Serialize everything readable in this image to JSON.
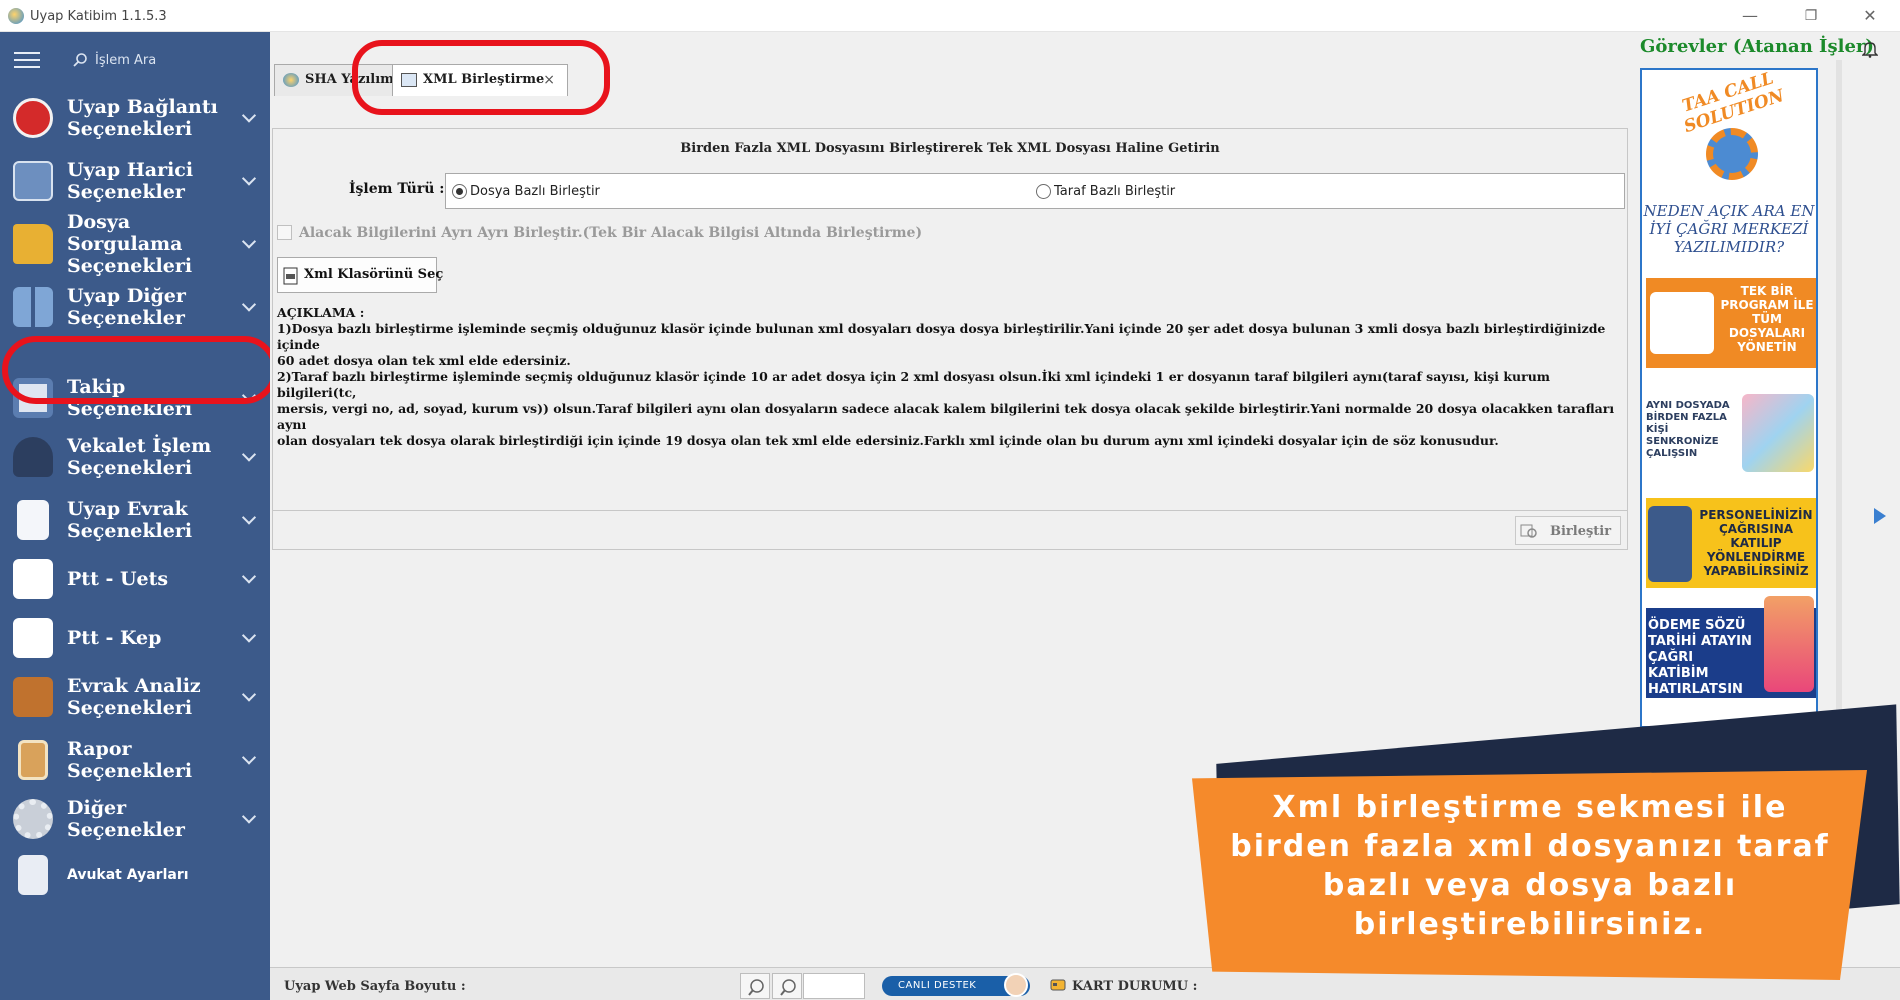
{
  "window": {
    "title": "Uyap Katibim 1.1.5.3",
    "controls": [
      "—",
      "❐",
      "✕"
    ]
  },
  "sidebar": {
    "search_label": "İşlem Ara",
    "items": [
      {
        "label": "Uyap Bağlantı Seçenekleri",
        "icon": "uyap-logo-icon"
      },
      {
        "label": "Uyap Harici Seçenekler",
        "icon": "help-book-icon"
      },
      {
        "label": "Dosya Sorgulama Seçenekleri",
        "icon": "folder-icon"
      },
      {
        "label": "Uyap Diğer Seçenekler",
        "icon": "grid-icon"
      },
      {
        "label": "Takip Seçenekleri",
        "icon": "frame-icon"
      },
      {
        "label": "Vekalet İşlem Seçenekleri",
        "icon": "lawyer-icon"
      },
      {
        "label": "Uyap Evrak Seçenekleri",
        "icon": "document-icon"
      },
      {
        "label": "Ptt - Uets",
        "icon": "ptt-icon"
      },
      {
        "label": "Ptt - Kep",
        "icon": "ptt-icon"
      },
      {
        "label": "Evrak Analiz Seçenekleri",
        "icon": "briefcase-icon"
      },
      {
        "label": "Rapor Seçenekleri",
        "icon": "clipboard-icon"
      },
      {
        "label": "Diğer Seçenekler",
        "icon": "gear-icon"
      },
      {
        "label": "Avukat Ayarları",
        "icon": "user-card-icon"
      }
    ]
  },
  "tabs": [
    {
      "label": "SHA Yazılım",
      "active": false
    },
    {
      "label": "XML Birleştirme",
      "active": true,
      "close": "×"
    }
  ],
  "panel": {
    "title": "Birden Fazla XML Dosyasını Birleştirerek Tek XML Dosyası Haline Getirin",
    "islem_label": "İşlem Türü :",
    "radio_options": [
      {
        "label": "Dosya Bazlı Birleştir",
        "selected": true
      },
      {
        "label": "Taraf Bazlı Birleştir",
        "selected": false
      }
    ],
    "checkbox_label": "Alacak Bilgilerini Ayrı Ayrı Birleştir.(Tek Bir Alacak Bilgisi Altında Birleştirme)",
    "select_button": "Xml Klasörünü Seç",
    "description": "AÇIKLAMA :\n1)Dosya bazlı birleştirme işleminde seçmiş olduğunuz klasör içinde bulunan xml dosyaları dosya dosya birleştirilir.Yani içinde 20 şer adet dosya bulunan 3 xmli dosya bazlı birleştirdiğinizde içinde\n60 adet dosya olan tek xml elde edersiniz.\n2)Taraf bazlı birleştirme işleminde seçmiş olduğunuz klasör içinde 10 ar adet dosya için 2 xml dosyası olsun.İki xml içindeki 1 er dosyanın taraf bilgileri aynı(taraf sayısı, kişi kurum bilgileri(tc,\nmersis, vergi no, ad, soyad, kurum vs)) olsun.Taraf bilgileri aynı olan dosyaların sadece alacak kalem bilgilerini tek dosya olacak şekilde birleştirir.Yani normalde 20 dosya olacakken tarafları aynı\nolan dosyaları tek dosya olarak birleştirdiği için içinde 19 dosya olan tek xml elde edersiniz.Farklı xml içinde olan bu durum aynı xml içindeki dosyalar için de söz konusudur.",
    "merge_button": "Birleştir"
  },
  "right_panel": {
    "tasks_title": "Görevler (Atanan İşler)",
    "ad": {
      "brand": "TAA CALL SOLUTION",
      "why": "NEDEN AÇIK ARA EN İYİ ÇAĞRI MERKEZİ YAZILIMIDIR?",
      "cards": [
        "TEK BİR PROGRAM İLE TÜM DOSYALARI YÖNETİN",
        "AYNI DOSYADA BİRDEN FAZLA KİŞİ SENKRONİZE ÇALIŞSIN",
        "PERSONELİNİZİN ÇAĞRISINA KATILIP YÖNLENDİRME YAPABİLİRSİNİZ",
        "ÖDEME SÖZÜ TARİHİ ATAYIN ÇAĞRI KATİBİM HATIRLATSIN"
      ]
    }
  },
  "statusbar": {
    "page_size_label": "Uyap Web Sayfa Boyutu :",
    "live_support": "CANLI DESTEK",
    "card_status": "KART DURUMU :"
  },
  "callout": {
    "text": "Xml birleştirme sekmesi ile birden fazla xml dosyanızı taraf bazlı veya dosya bazlı birleştirebilirsiniz."
  },
  "colors": {
    "sidebar_bg": "#3c5a8a",
    "highlight": "#e8131c",
    "callout_bg": "#f58a2b",
    "tasks_green": "#1c8a2b",
    "ad_border": "#2c76c9"
  }
}
